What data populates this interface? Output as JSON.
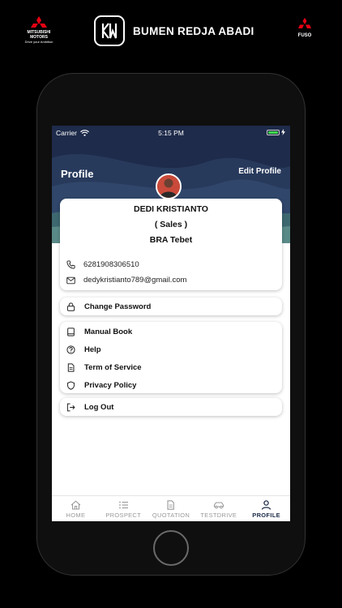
{
  "brand": {
    "left_logo_line1": "MITSUBISHI",
    "left_logo_line2": "MOTORS",
    "left_logo_tagline": "Drive your Ambition",
    "company_name": "BUMEN REDJA ABADI",
    "right_logo_text": "FUSO"
  },
  "status_bar": {
    "carrier": "Carrier",
    "time": "5:15 PM"
  },
  "header": {
    "title": "Profile",
    "edit_label": "Edit Profile"
  },
  "profile": {
    "name": "DEDI KRISTIANTO",
    "role": "( Sales )",
    "branch": "BRA Tebet",
    "phone": "6281908306510",
    "email": "dedykristianto789@gmail.com"
  },
  "menu": {
    "change_password": "Change Password",
    "manual_book": "Manual Book",
    "help": "Help",
    "terms": "Term of Service",
    "privacy": "Privacy  Policy",
    "logout": "Log Out"
  },
  "tabs": [
    {
      "label": "HOME",
      "icon": "home-icon",
      "active": false
    },
    {
      "label": "PROSPECT",
      "icon": "list-icon",
      "active": false
    },
    {
      "label": "QUOTATION",
      "icon": "document-icon",
      "active": false
    },
    {
      "label": "TESTDRIVE",
      "icon": "car-icon",
      "active": false
    },
    {
      "label": "PROFILE",
      "icon": "user-icon",
      "active": true
    }
  ],
  "colors": {
    "header_dark": "#1e2b4a",
    "header_teal": "#4c7a7c",
    "accent_active": "#1f2d4a",
    "battery": "#3fd84a"
  }
}
